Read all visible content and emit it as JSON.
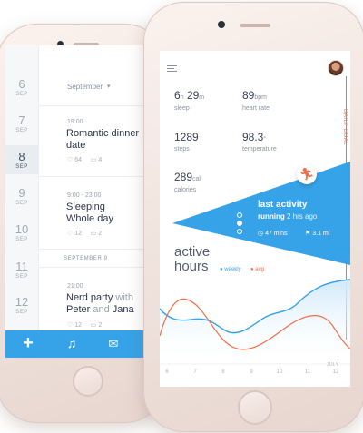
{
  "calendar": {
    "month_label": "September",
    "days": [
      {
        "num": "6",
        "mon": "SEP"
      },
      {
        "num": "7",
        "mon": "SEP"
      },
      {
        "num": "8",
        "mon": "SEP"
      },
      {
        "num": "9",
        "mon": "SEP"
      },
      {
        "num": "10",
        "mon": "SEP"
      },
      {
        "num": "11",
        "mon": "SEP"
      },
      {
        "num": "12",
        "mon": "SEP"
      }
    ],
    "events": [
      {
        "time": "19:00",
        "title_1": "Romantic dinner",
        "title_2": "date",
        "likes": "64",
        "comments": "4"
      },
      {
        "time": "9:00 - 23:00",
        "title_1": "Sleeping",
        "title_2": "Whole day",
        "likes": "12",
        "comments": "2"
      },
      {
        "time": "21:00",
        "title_1": "Nerd party",
        "title_1_light": "with",
        "title_2": "Peter",
        "title_2_light": "and",
        "title_3": "Jana",
        "likes": "12",
        "comments": "2"
      }
    ],
    "section_label": "SEPTEMBER 9",
    "tabs": [
      "plus-icon",
      "music-note-icon",
      "mail-icon"
    ]
  },
  "fitness": {
    "stats": [
      {
        "value_a": "6",
        "unit_a": "h",
        "value_b": "29",
        "unit_b": "m",
        "label": "sleep"
      },
      {
        "value_a": "89",
        "unit_a": "bpm",
        "label": "heart rate"
      },
      {
        "value_a": "1289",
        "unit_a": "",
        "label": "steps"
      },
      {
        "value_a": "98.3",
        "unit_a": "°",
        "label": "temperature"
      },
      {
        "value_a": "289",
        "unit_a": "cal",
        "label": "calories"
      }
    ],
    "daily_goal": "DAILY GOAL",
    "last_activity": {
      "title": "last activity",
      "type": "running",
      "ago": "2 hrs ago",
      "duration": "47 mins",
      "distance": "3.1 mi"
    },
    "active_hours": {
      "title_1": "active",
      "title_2": "hours",
      "legend_weekly": "weekly",
      "legend_avg": "avg"
    },
    "x_ticks": [
      "6",
      "7",
      "8",
      "9",
      "10",
      "11",
      "12"
    ],
    "month_tick": "JULY",
    "colors": {
      "accent": "#36a3e8",
      "orange": "#f06f4a"
    }
  }
}
